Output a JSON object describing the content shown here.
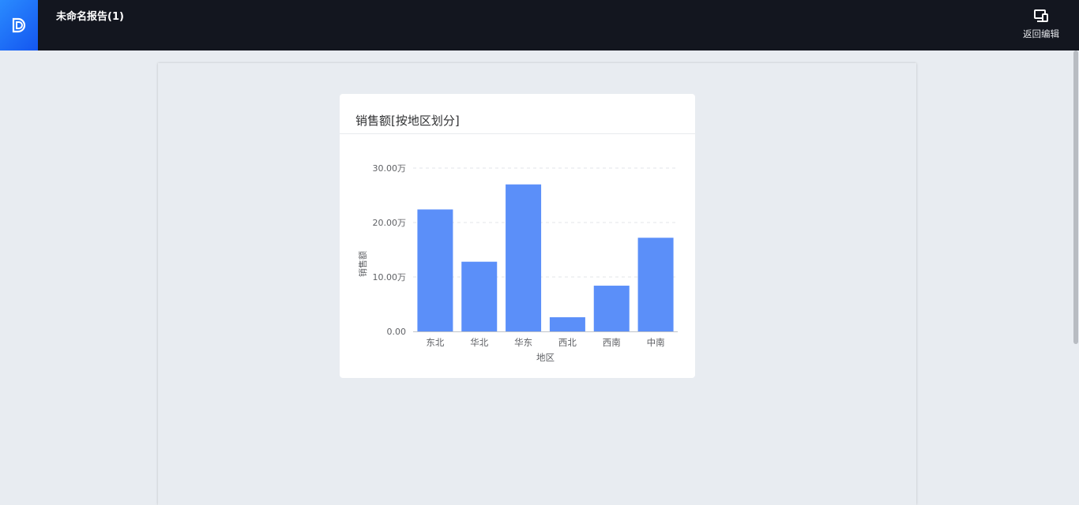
{
  "header": {
    "report_title": "未命名报告(1)",
    "back_edit_label": "返回编辑"
  },
  "colors": {
    "topbar_bg": "#13161f",
    "accent": "#1456f0",
    "bar": "#5b8ff9"
  },
  "icons": {
    "logo": "logo-icon",
    "back_edit": "monitor-icon"
  },
  "chart_data": {
    "type": "bar",
    "title": "销售额[按地区划分]",
    "xlabel": "地区",
    "ylabel": "销售额",
    "categories": [
      "东北",
      "华北",
      "华东",
      "西北",
      "西南",
      "中南"
    ],
    "values": [
      224000,
      128000,
      270000,
      26000,
      84000,
      172000
    ],
    "ylim": [
      0,
      300000
    ],
    "yticks": [
      0,
      100000,
      200000,
      300000
    ],
    "ytick_labels": [
      "0.00",
      "10.00万",
      "20.00万",
      "30.00万"
    ],
    "grid": true,
    "legend": "none"
  }
}
